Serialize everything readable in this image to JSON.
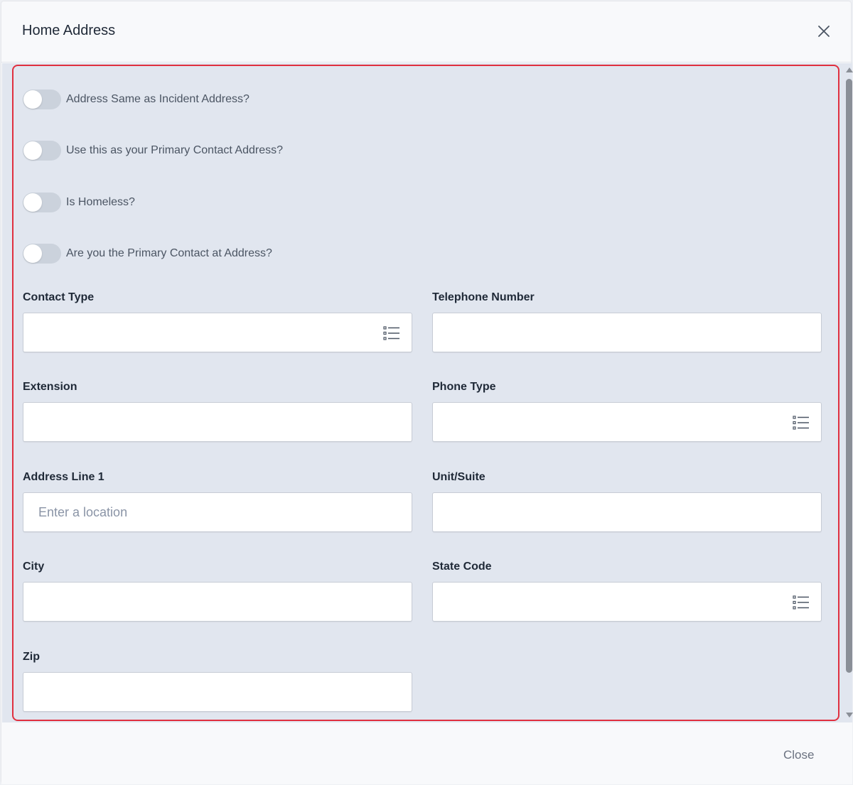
{
  "dialog": {
    "title": "Home Address",
    "close_icon": "close-icon"
  },
  "toggles": [
    {
      "label": "Address Same as Incident Address?",
      "checked": false
    },
    {
      "label": "Use this as your Primary Contact Address?",
      "checked": false
    },
    {
      "label": "Is Homeless?",
      "checked": false
    },
    {
      "label": "Are you the Primary Contact at Address?",
      "checked": false
    }
  ],
  "fields": {
    "contact_type": {
      "label": "Contact Type",
      "value": "",
      "icon": "list-icon"
    },
    "telephone_number": {
      "label": "Telephone Number",
      "value": ""
    },
    "extension": {
      "label": "Extension",
      "value": ""
    },
    "phone_type": {
      "label": "Phone Type",
      "value": "",
      "icon": "list-icon"
    },
    "address_line_1": {
      "label": "Address Line 1",
      "value": "",
      "placeholder": "Enter a location"
    },
    "unit_suite": {
      "label": "Unit/Suite",
      "value": ""
    },
    "city": {
      "label": "City",
      "value": ""
    },
    "state_code": {
      "label": "State Code",
      "value": "",
      "icon": "list-icon"
    },
    "zip": {
      "label": "Zip",
      "value": ""
    }
  },
  "footer": {
    "close_label": "Close"
  },
  "colors": {
    "highlight_border": "#e0303f",
    "form_background": "#e1e6ef",
    "toggle_off": "#cbd2dc"
  }
}
